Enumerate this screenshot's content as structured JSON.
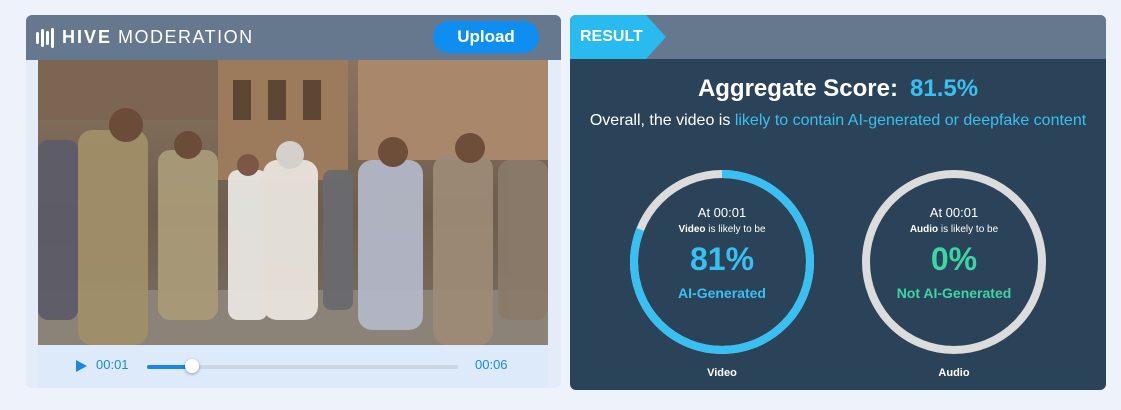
{
  "header": {
    "brand_bold": "HIVE",
    "brand_light": "MODERATION",
    "upload_label": "Upload"
  },
  "player": {
    "current_time": "00:01",
    "duration": "00:06",
    "progress": 0.145
  },
  "result": {
    "tag": "RESULT",
    "aggregate_label": "Aggregate Score:",
    "aggregate_value": "81.5%",
    "overall_prefix": "Overall, the video is",
    "overall_highlight": "likely to contain AI-generated or deepfake content"
  },
  "gauges": [
    {
      "at": "At 00:01",
      "type_word": "Video",
      "likely_suffix": "is likely to be",
      "percent_text": "81%",
      "fraction": 0.81,
      "label": "AI-Generated",
      "caption": "Video",
      "color": "#38c0f2"
    },
    {
      "at": "At 00:01",
      "type_word": "Audio",
      "likely_suffix": "is likely to be",
      "percent_text": "0%",
      "fraction": 0.0,
      "label": "Not AI-Generated",
      "caption": "Audio",
      "color": "#3bd6a4"
    }
  ],
  "colors": {
    "accent": "#29bbf0",
    "button": "#0d8ef0",
    "panel": "#2b4358",
    "header": "#66788d",
    "track": "#dcdcdc"
  }
}
